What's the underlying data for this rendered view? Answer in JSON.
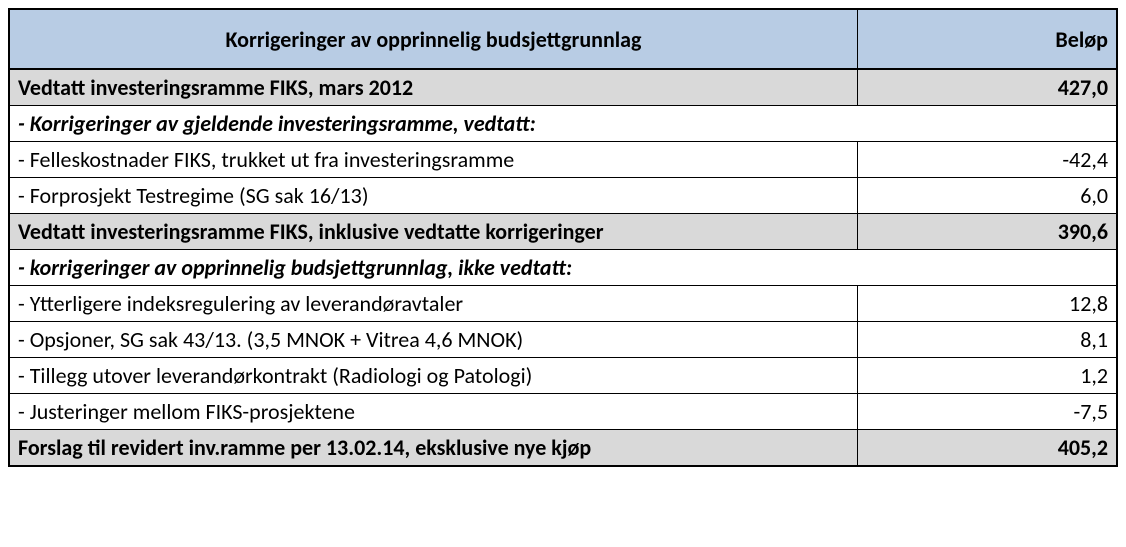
{
  "header": {
    "col1": "Korrigeringer av opprinnelig budsjettgrunnlag",
    "col2": "Beløp"
  },
  "rows": [
    {
      "type": "total",
      "label": "Vedtatt investeringsramme FIKS, mars 2012",
      "value": "427,0",
      "hasValue": true
    },
    {
      "type": "subheader",
      "label": " - Korrigeringer av gjeldende investeringsramme, vedtatt:",
      "hasValue": false
    },
    {
      "type": "item",
      "label": " - Felleskostnader FIKS, trukket ut fra investeringsramme",
      "value": "-42,4",
      "hasValue": true
    },
    {
      "type": "item",
      "label": " - Forprosjekt Testregime (SG sak 16/13)",
      "value": "6,0",
      "hasValue": true
    },
    {
      "type": "total",
      "label": "Vedtatt investeringsramme FIKS, inklusive vedtatte korrigeringer",
      "value": "390,6",
      "hasValue": true
    },
    {
      "type": "subheader",
      "label": " - korrigeringer av opprinnelig budsjettgrunnlag, ikke vedtatt:",
      "hasValue": false
    },
    {
      "type": "item",
      "label": " - Ytterligere indeksregulering av leverandøravtaler",
      "value": "12,8",
      "hasValue": true
    },
    {
      "type": "item",
      "label": " - Opsjoner, SG sak 43/13. (3,5 MNOK + Vitrea 4,6 MNOK)",
      "value": "8,1",
      "hasValue": true
    },
    {
      "type": "item",
      "label": " - Tillegg utover leverandørkontrakt (Radiologi og Patologi)",
      "value": "1,2",
      "hasValue": true
    },
    {
      "type": "item",
      "label": " - Justeringer mellom FIKS-prosjektene",
      "value": "-7,5",
      "hasValue": true
    },
    {
      "type": "total",
      "label": "Forslag til revidert inv.ramme per 13.02.14, eksklusive nye kjøp",
      "value": "405,2",
      "hasValue": true
    }
  ]
}
